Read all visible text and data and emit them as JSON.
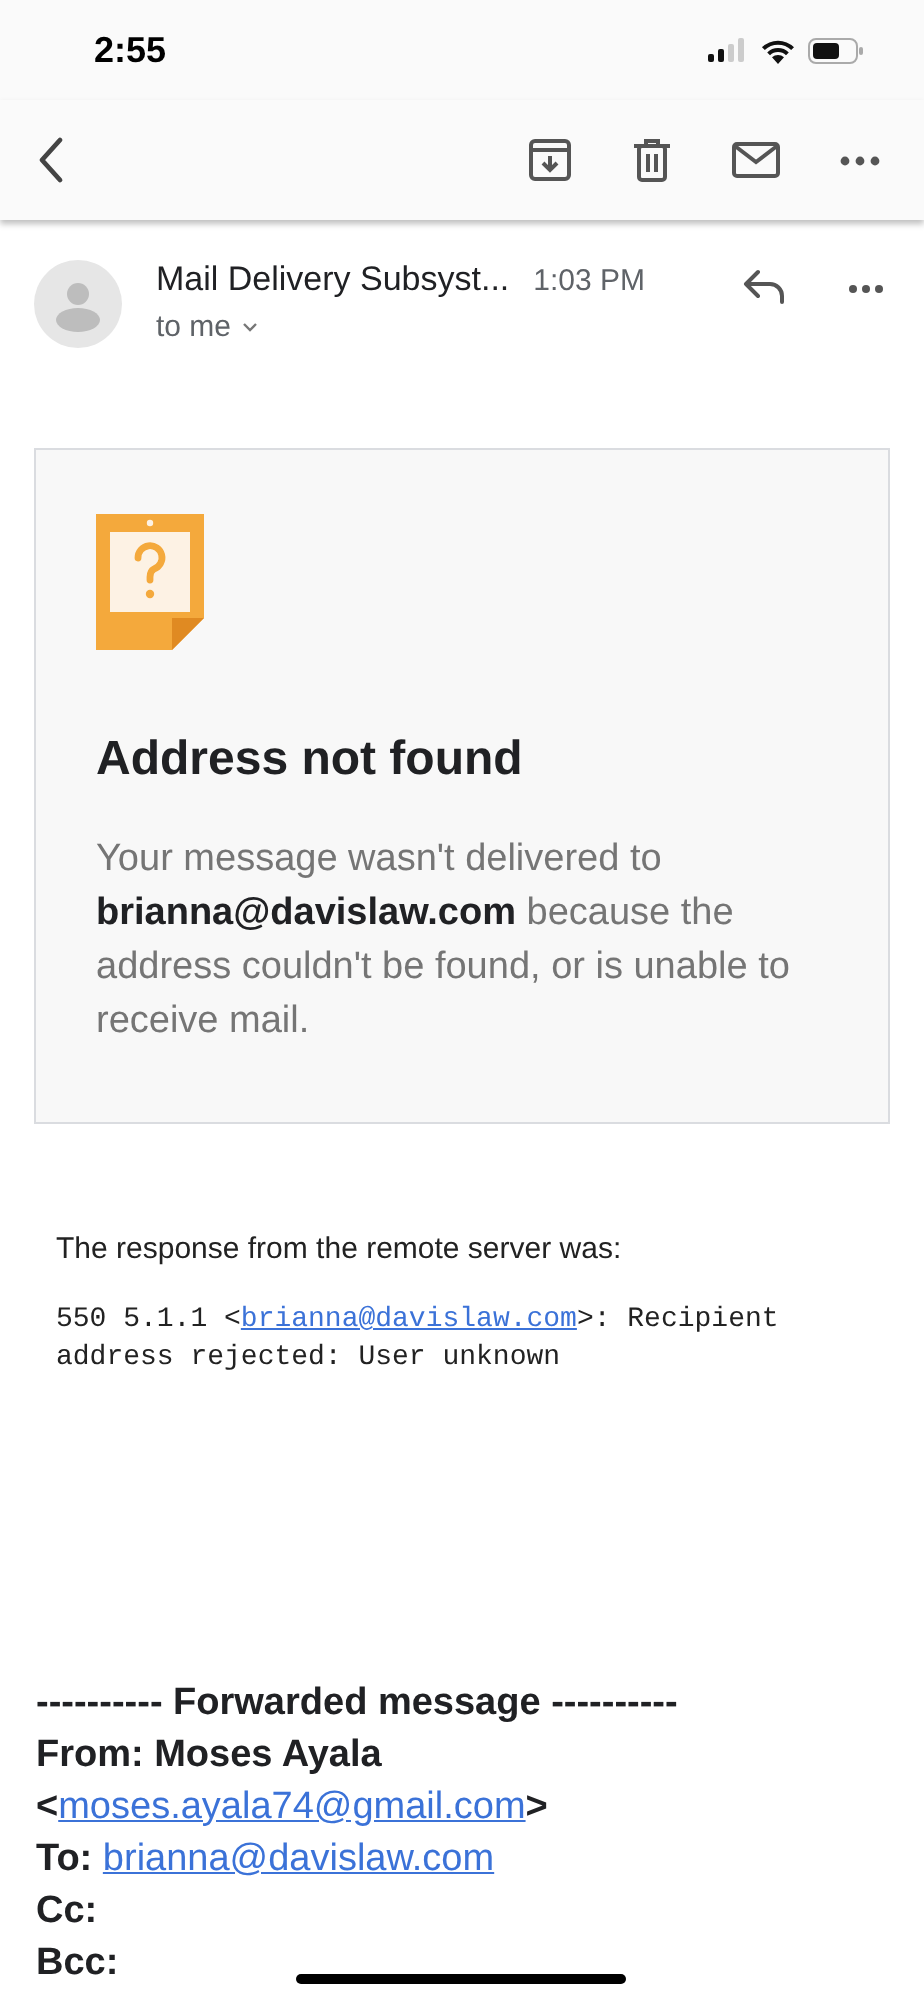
{
  "status_bar": {
    "time": "2:55"
  },
  "message_header": {
    "sender": "Mail Delivery Subsyst...",
    "time": "1:03 PM",
    "recipient": "to me"
  },
  "bounce_card": {
    "title": "Address not found",
    "message": "Your message wasn't delivered to **brianna@davislaw.com** because the address couldn't be found, or is unable to receive mail."
  },
  "server_response": {
    "intro": "The response from the remote server was:",
    "code_before": "550 5.1.1 <",
    "code_link": "brianna@davislaw.com",
    "code_after": ">: Recipient address rejected: User unknown"
  },
  "forwarded": {
    "divider": "---------- Forwarded message ----------",
    "from": "From: Moses Ayala",
    "from_before": "<",
    "from_email": "moses.ayala74@gmail.com",
    "from_after": ">",
    "to_label": "To:",
    "to_email": "brianna@davislaw.com",
    "cc": "Cc:",
    "bcc": "Bcc:"
  }
}
